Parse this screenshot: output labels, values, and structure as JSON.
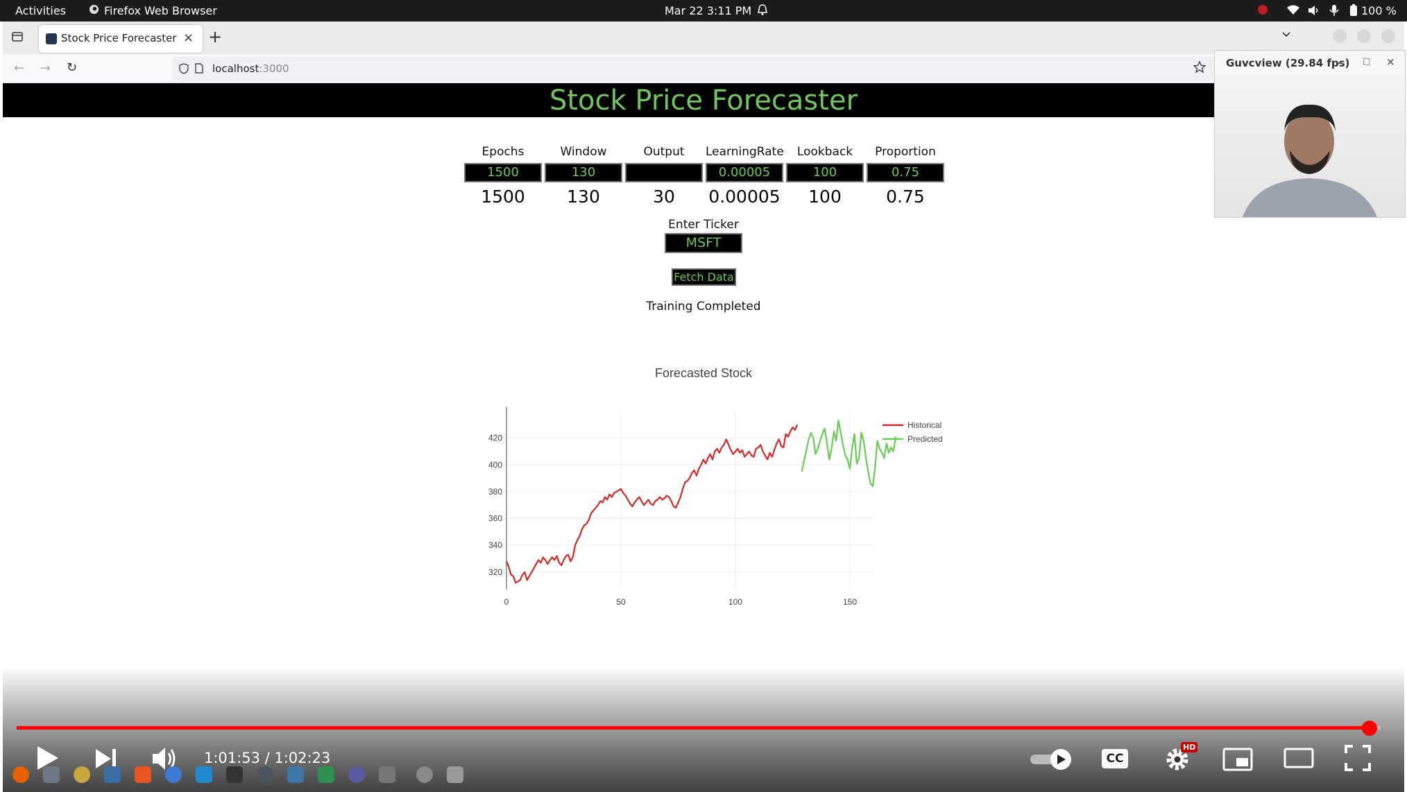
{
  "os": {
    "activities": "Activities",
    "app_name": "Firefox Web Browser",
    "datetime": "Mar 22  3:11 PM",
    "battery": "100 %"
  },
  "browser": {
    "tab_title": "Stock Price Forecaster",
    "url_host": "localhost",
    "url_port": ":3000"
  },
  "app": {
    "title": "Stock Price Forecaster",
    "params": [
      {
        "label": "Epochs",
        "input": "1500",
        "value": "1500"
      },
      {
        "label": "Window",
        "input": "130",
        "value": "130"
      },
      {
        "label": "Output",
        "input": "",
        "value": "30"
      },
      {
        "label": "LearningRate",
        "input": "0.00005",
        "value": "0.00005"
      },
      {
        "label": "Lookback",
        "input": "100",
        "value": "100"
      },
      {
        "label": "Proportion",
        "input": "0.75",
        "value": "0.75"
      }
    ],
    "ticker_label": "Enter Ticker",
    "ticker_value": "MSFT",
    "fetch_button": "Fetch Data",
    "status": "Training Completed"
  },
  "chart_data": {
    "type": "line",
    "title": "Forecasted Stock",
    "xlabel": "",
    "ylabel": "",
    "xlim": [
      0,
      160
    ],
    "ylim": [
      307,
      440
    ],
    "x_ticks": [
      0,
      50,
      100,
      150
    ],
    "y_ticks": [
      320,
      340,
      360,
      380,
      400,
      420
    ],
    "grid": true,
    "legend_position": "top-right",
    "colors": {
      "Historical": "#d62728",
      "Predicted": "#66cc52"
    },
    "series": [
      {
        "name": "Historical",
        "x_start": 0,
        "values": [
          328,
          324,
          318,
          317,
          312,
          313,
          314,
          318,
          320,
          314,
          317,
          320,
          323,
          326,
          329,
          327,
          331,
          329,
          326,
          329,
          331,
          329,
          332,
          327,
          325,
          329,
          332,
          333,
          328,
          331,
          340,
          344,
          347,
          352,
          355,
          356,
          359,
          364,
          366,
          368,
          370,
          373,
          372,
          376,
          374,
          378,
          376,
          379,
          380,
          381,
          382,
          379,
          377,
          374,
          371,
          369,
          372,
          374,
          376,
          373,
          370,
          372,
          374,
          371,
          370,
          373,
          374,
          376,
          374,
          375,
          377,
          376,
          373,
          369,
          368,
          372,
          376,
          382,
          387,
          388,
          390,
          394,
          396,
          392,
          397,
          400,
          404,
          401,
          405,
          408,
          404,
          410,
          412,
          409,
          413,
          415,
          419,
          415,
          411,
          408,
          410,
          412,
          409,
          411,
          406,
          408,
          410,
          407,
          406,
          412,
          413,
          415,
          410,
          407,
          404,
          409,
          406,
          411,
          416,
          419,
          414,
          413,
          423,
          421,
          425,
          428,
          426,
          430
        ]
      },
      {
        "name": "Predicted",
        "x_start": 129,
        "values": [
          395,
          403,
          411,
          419,
          424,
          420,
          408,
          412,
          418,
          423,
          427,
          416,
          404,
          412,
          425,
          418,
          433,
          424,
          415,
          407,
          404,
          397,
          412,
          423,
          401,
          405,
          424,
          418,
          405,
          395,
          386,
          384,
          398,
          418,
          412,
          409,
          405,
          416,
          409,
          413,
          410,
          421
        ]
      }
    ]
  },
  "video": {
    "time": "1:01:53 / 1:02:23",
    "progress": 0.992,
    "hd_badge": "HD",
    "cc_label": "CC"
  },
  "webcam": {
    "title": "Guvcview  (29.84 fps)"
  }
}
